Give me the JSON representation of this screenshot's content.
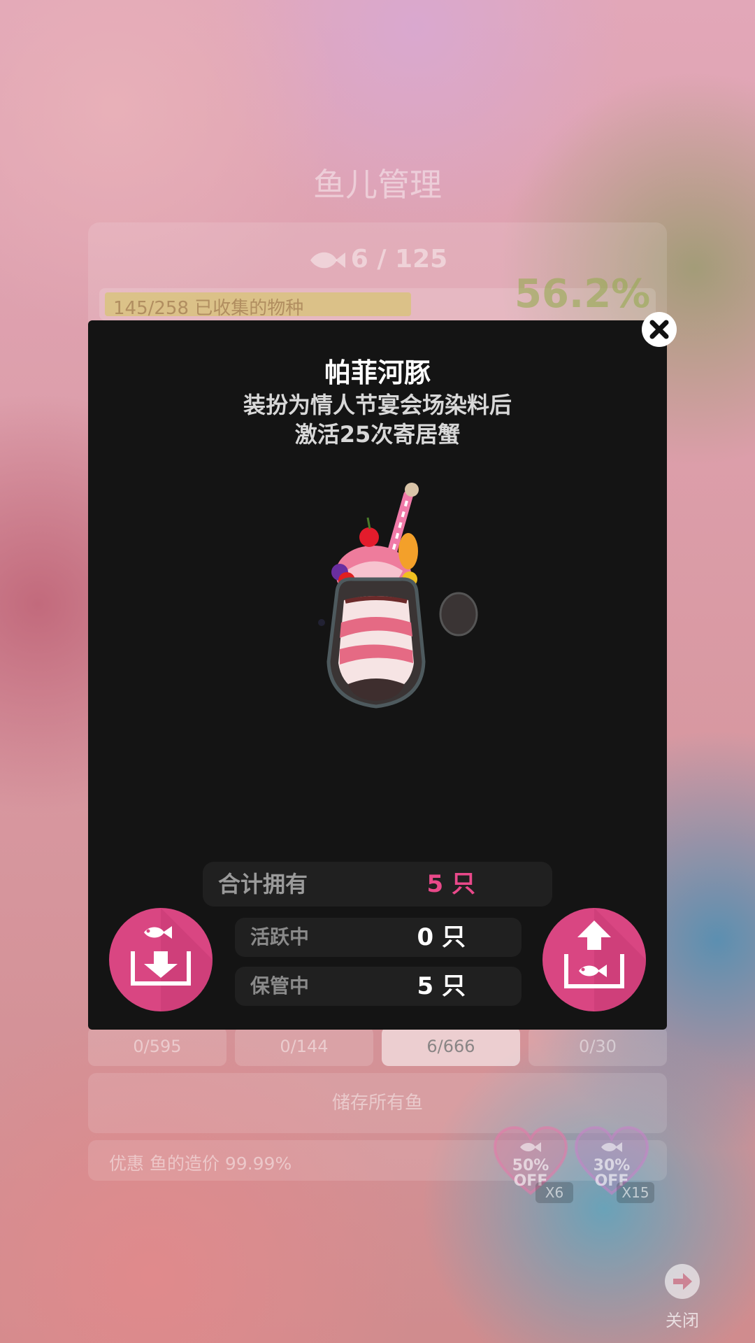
{
  "background": {
    "page_title": "鱼儿管理",
    "fish_count": "6 / 125",
    "collection_text": "145/258 已收集的物种",
    "collection_progress": 0.562,
    "collection_percent": "56.2%",
    "tabs": [
      {
        "label": "0/595"
      },
      {
        "label": "0/144"
      },
      {
        "label": "6/666"
      },
      {
        "label": "0/30"
      }
    ],
    "store_all_label": "储存所有鱼",
    "discount_text": "优惠 鱼的造价 99.99%",
    "coupons": [
      {
        "percent": "50%",
        "off": "OFF",
        "multiplier": "X6"
      },
      {
        "percent": "30%",
        "off": "OFF",
        "multiplier": "X15"
      }
    ],
    "close_label": "关闭"
  },
  "dialog": {
    "title": "帕菲河豚",
    "description_line1": "装扮为情人节宴会场染料后",
    "description_line2": "激活25次寄居蟹",
    "total": {
      "label": "合计拥有",
      "value": "5 只"
    },
    "active": {
      "label": "活跃中",
      "value": "0 只"
    },
    "stored": {
      "label": "保管中",
      "value": "5 只"
    },
    "accent_color": "#d94682",
    "total_value_color": "#e9498a"
  }
}
